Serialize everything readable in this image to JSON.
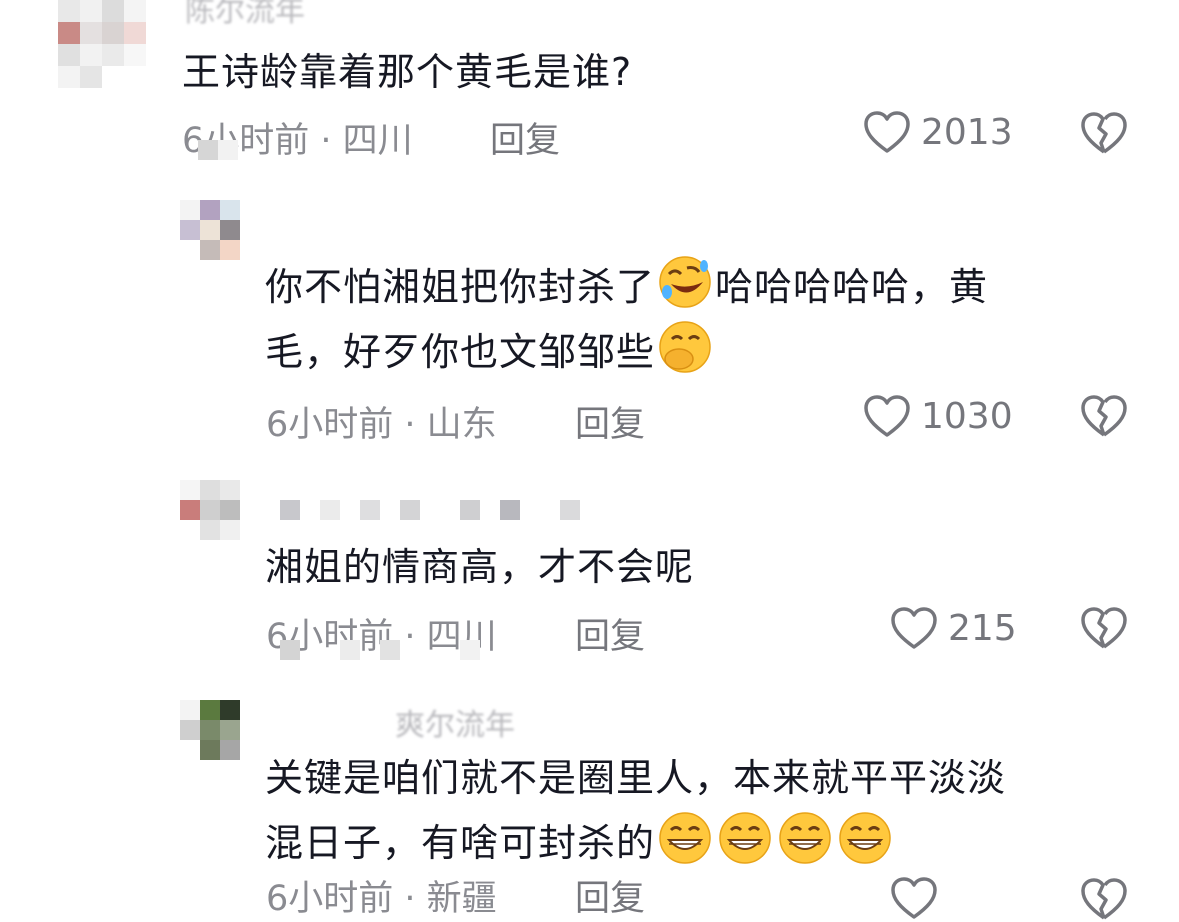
{
  "comments": [
    {
      "username": "陈尔流年",
      "text": "王诗龄靠着那个黄毛是谁?",
      "meta": "6小时前 · 四川",
      "reply_label": "回复",
      "likes": "2013"
    },
    {
      "username": "",
      "text_line1": "你不怕湘姐把你封杀了",
      "text_line1_after": "哈哈哈哈哈，黄",
      "text_line2": "毛，好歹你也文邹邹些",
      "meta": "6小时前 · 山东",
      "reply_label": "回复",
      "likes": "1030"
    },
    {
      "username": "",
      "text": "湘姐的情商高，才不会呢",
      "meta": "6小时前 · 四川",
      "reply_label": "回复",
      "likes": "215"
    },
    {
      "username": "爽尔流年",
      "text_line1": "关键是咱们就不是圈里人，本来就平平淡淡",
      "text_line2": "混日子，有啥可封杀的",
      "meta": "6小时前 · 新疆",
      "reply_label": "回复"
    }
  ],
  "icons": {
    "like": "heart-outline-icon",
    "dislike": "broken-heart-icon",
    "emoji_laugh": "rolling-on-floor-laughing-emoji",
    "emoji_giggle": "face-with-hand-over-mouth-emoji",
    "emoji_grin": "grinning-face-emoji"
  },
  "colors": {
    "text_primary": "#161823",
    "text_secondary": "#8a8b91",
    "icon_gray": "#75767c"
  }
}
